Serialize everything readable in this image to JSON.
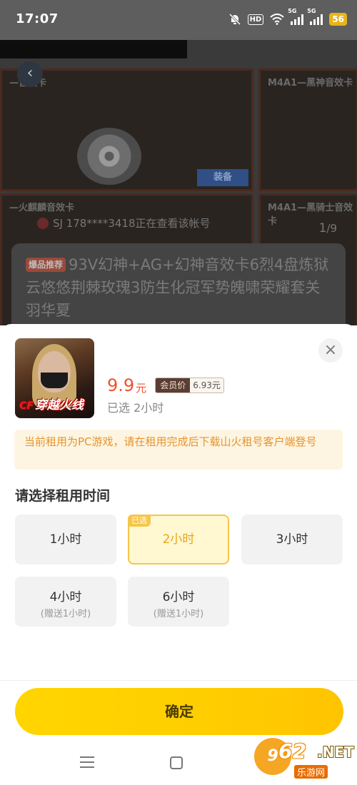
{
  "status_bar": {
    "time": "17:07",
    "hd": "HD",
    "net1": "5G",
    "net2": "5G",
    "battery": "56",
    "icons": [
      "mute-bell-icon",
      "wifi-icon",
      "signal-icon",
      "signal-icon"
    ]
  },
  "background": {
    "card_titles": [
      "—音效卡",
      "M4A1—黑神音效卡",
      "—火麒麟音效卡",
      "M4A1—黑骑士音效卡"
    ],
    "equip_label": "装备",
    "viewer_text": "SJ 178****3418正在查看该帐号",
    "page_current": "1",
    "page_total": "/9",
    "hot_tag": "爆品推荐",
    "product_title": "93V幻神+AG+幻神音效卡6烈4盘炼狱云悠悠荆棘玫瑰3防生化冠军势魄啸荣耀套关羽华夏"
  },
  "sheet": {
    "game_logo": "穿越火线",
    "game_logo_prefix": "CF",
    "price": "9.9",
    "price_unit": "元",
    "member_label": "会员价",
    "member_price": "6.93元",
    "selected_info": "已选 2小时",
    "notice": "当前租用为PC游戏，请在租用完成后下载山火租号客户端登号",
    "section_title": "请选择租用时间",
    "options": [
      {
        "label": "1小时",
        "sub": ""
      },
      {
        "label": "2小时",
        "sub": "",
        "selected": true,
        "tag": "已选"
      },
      {
        "label": "3小时",
        "sub": ""
      },
      {
        "label": "4小时",
        "sub": "(赠送1小时)"
      },
      {
        "label": "6小时",
        "sub": "(赠送1小时)"
      }
    ],
    "confirm": "确定",
    "close_icon": "close-icon"
  },
  "nav": {
    "icons": [
      "menu-icon",
      "home-icon"
    ]
  },
  "watermark": {
    "prefix": "9",
    "number": "62",
    "suffix": ".NET",
    "cn": "乐游网"
  },
  "colors": {
    "accent_yellow": "#ffd500",
    "price_red": "#f0502e",
    "notice_text": "#e8932a",
    "overlay": "#5e5e5e"
  }
}
